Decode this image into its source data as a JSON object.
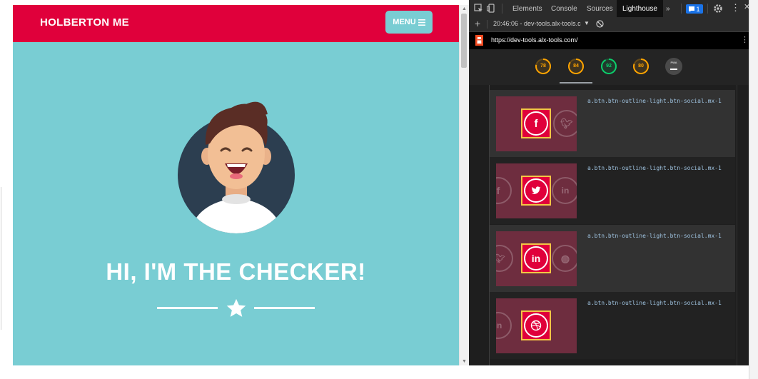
{
  "site": {
    "brand": "HOLBERTON ME",
    "menu_label": "MENU",
    "hero_title": "HI, I'M THE CHECKER!",
    "colors": {
      "primary": "#e0003b",
      "teal": "#79cdd3"
    }
  },
  "devtools": {
    "tabs": [
      "Elements",
      "Console",
      "Sources",
      "Lighthouse"
    ],
    "active_tab": "Lighthouse",
    "more_tabs": "»",
    "message_count": "1",
    "report_label": "20:46:06 - dev-tools.alx-tools.c",
    "url": "https://dev-tools.alx-tools.com/",
    "scores": [
      {
        "value": "78",
        "fraction": 0.78,
        "color": "#ffa400"
      },
      {
        "value": "84",
        "fraction": 0.84,
        "color": "#ffa400"
      },
      {
        "value": "92",
        "fraction": 0.92,
        "color": "#0cce6b"
      },
      {
        "value": "80",
        "fraction": 0.8,
        "color": "#ffa400"
      }
    ],
    "pwa_label": "PWA",
    "audit_items": [
      {
        "selector": "a.btn.btn-outline-light.btn-social.mx-1",
        "icon": "facebook-icon",
        "glyph": "f"
      },
      {
        "selector": "a.btn.btn-outline-light.btn-social.mx-1",
        "icon": "twitter-icon",
        "glyph": ""
      },
      {
        "selector": "a.btn.btn-outline-light.btn-social.mx-1",
        "icon": "linkedin-icon",
        "glyph": "in"
      },
      {
        "selector": "a.btn.btn-outline-light.btn-social.mx-1",
        "icon": "dribbble-icon",
        "glyph": ""
      }
    ]
  }
}
